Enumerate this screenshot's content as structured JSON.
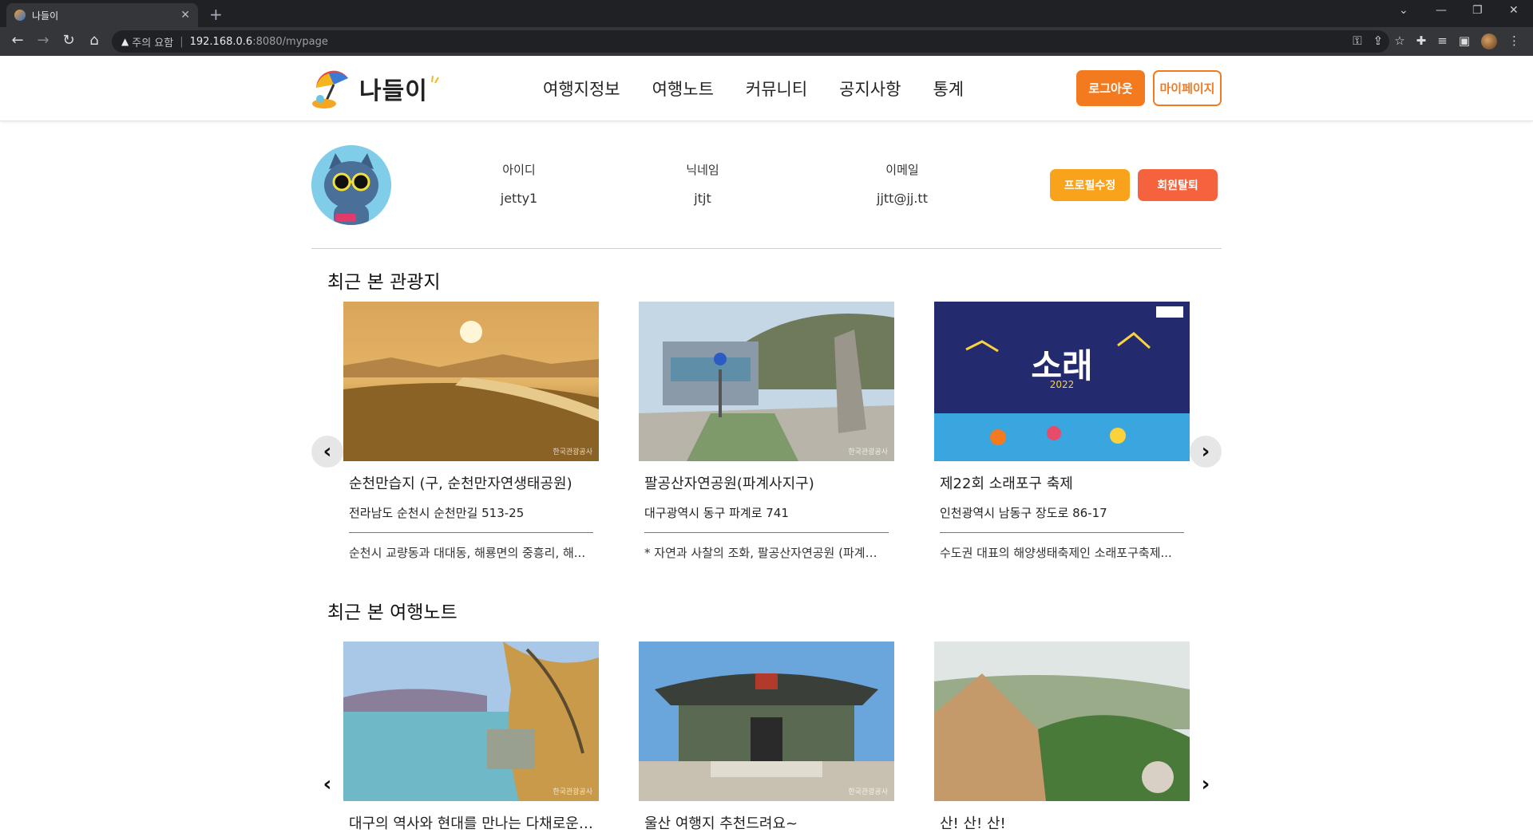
{
  "browser": {
    "tab_title": "나들이",
    "security_label": "주의 요함",
    "url_host": "192.168.0.6",
    "url_path": ":8080/mypage"
  },
  "site": {
    "logo_text": "나들이",
    "nav": [
      "여행지정보",
      "여행노트",
      "커뮤니티",
      "공지사항",
      "통계"
    ],
    "logout_label": "로그아웃",
    "mypage_label": "마이페이지"
  },
  "profile": {
    "id_label": "아이디",
    "id_value": "jetty1",
    "nickname_label": "닉네임",
    "nickname_value": "jtjt",
    "email_label": "이메일",
    "email_value": "jjtt@jj.tt",
    "edit_label": "프로필수정",
    "withdraw_label": "회원탈퇴"
  },
  "recent_spots": {
    "title": "최근 본 관광지",
    "items": [
      {
        "name": "순천만습지 (구, 순천만자연생태공원)",
        "address": "전라남도 순천시 순천만길 513-25",
        "desc": "순천시 교량동과 대대동, 해룡면의 중흥리, 해..."
      },
      {
        "name": "팔공산자연공원(파계사지구)",
        "address": "대구광역시 동구 파계로 741",
        "desc": "* 자연과 사찰의 조화, 팔공산자연공원 (파계사..."
      },
      {
        "name": "제22회 소래포구 축제",
        "address": "인천광역시 남동구 장도로 86-17",
        "desc": "수도권 대표의 해양생태축제인 소래포구축제..."
      }
    ]
  },
  "recent_notes": {
    "title": "최근 본 여행노트",
    "items": [
      {
        "name": "대구의 역사와 현대를 만나는 다채로운 ..."
      },
      {
        "name": "울산 여행지 추천드려요~"
      },
      {
        "name": "산! 산! 산!"
      }
    ]
  },
  "watermark": "한국관광공사",
  "icons": {
    "prev": "chevron-left-icon",
    "next": "chevron-right-icon"
  },
  "colors": {
    "accent_orange": "#f47a1f",
    "edit_yellow": "#f9a21c",
    "withdraw_red": "#f4623e"
  }
}
